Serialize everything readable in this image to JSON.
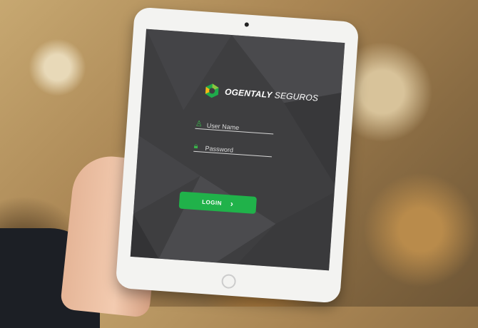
{
  "brand": {
    "name_bold": "OGENTALY",
    "name_light": "SEGUROS",
    "logo_colors": [
      "#1faa4b",
      "#f6b515",
      "#8dc63f"
    ]
  },
  "login_form": {
    "username_placeholder": "User Name",
    "password_placeholder": "Password",
    "username_icon": "user-icon",
    "password_icon": "lock-icon",
    "login_label": "LOGIN",
    "login_icon": "chevron-right-icon",
    "accent": "#20b24a"
  }
}
